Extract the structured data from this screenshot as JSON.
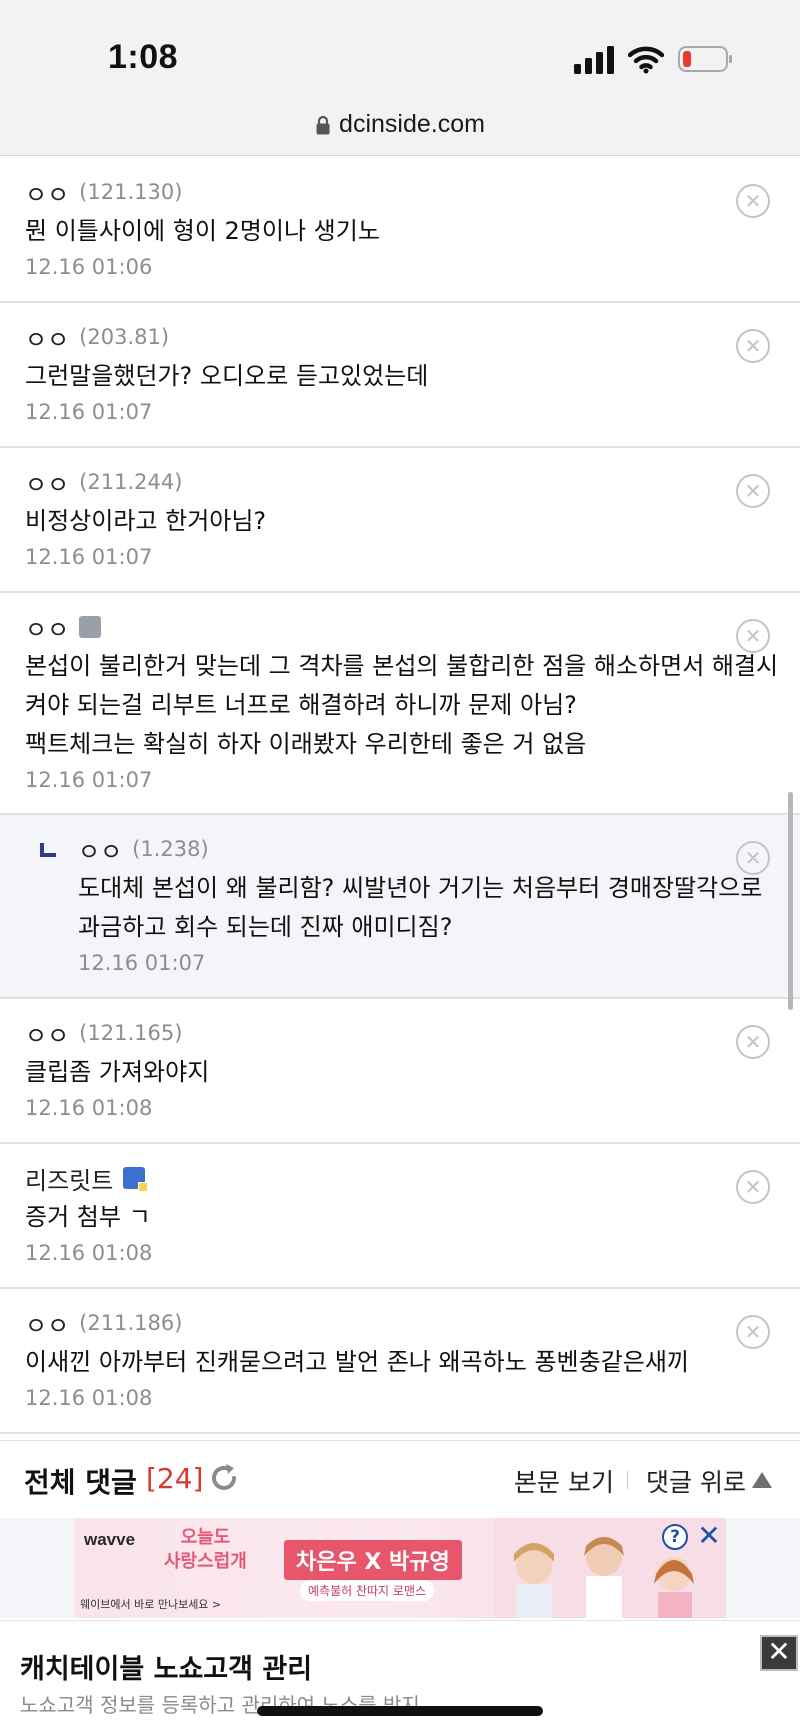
{
  "status_bar": {
    "time": "1:08"
  },
  "browser": {
    "url": "dcinside.com"
  },
  "comments": [
    {
      "nick": "ㅇㅇ",
      "ip": "(121.130)",
      "text": "뭔 이틀사이에 형이 2명이나 생기노",
      "date": "12.16 01:06"
    },
    {
      "nick": "ㅇㅇ",
      "ip": "(203.81)",
      "text": "그런말을했던가? 오디오로 듣고있었는데",
      "date": "12.16 01:07"
    },
    {
      "nick": "ㅇㅇ",
      "ip": "(211.244)",
      "text": "비정상이라고 한거아님?",
      "date": "12.16 01:07"
    },
    {
      "nick": "ㅇㅇ",
      "ip": "",
      "text": "본섭이 불리한거 맞는데 그 격차를 본섭의 불합리한 점을 해소하면서 해결시켜야 되는걸 리부트 너프로 해결하려 하니까 문제 아님?",
      "text2": "팩트체크는 확실히 하자 이래봤자 우리한테 좋은 거 없음",
      "date": "12.16 01:07"
    },
    {
      "nick": "ㅇㅇ",
      "ip": "(1.238)",
      "text": "도대체 본섭이 왜 불리함? 씨발년아 거기는 처음부터 경매장딸각으로 과금하고 회수 되는데 진짜 애미디짐?",
      "date": "12.16 01:07"
    },
    {
      "nick": "ㅇㅇ",
      "ip": "(121.165)",
      "text": "클립좀 가져와야지",
      "date": "12.16 01:08"
    },
    {
      "nick": "리즈릿트",
      "ip": "",
      "text": "증거 첨부 ㄱ",
      "date": "12.16 01:08"
    },
    {
      "nick": "ㅇㅇ",
      "ip": "(211.186)",
      "text": "이새낀 아까부터 진캐묻으려고 발언 존나 왜곡하노 퐁벤충같은새끼",
      "date": "12.16 01:08"
    }
  ],
  "total_bar": {
    "title": "전체 댓글",
    "count": "[24]",
    "view_post": "본문 보기",
    "to_comments": "댓글 위로"
  },
  "ad": {
    "brand": "wavve",
    "tagline_line1": "오늘도",
    "tagline_line2": "사랑스럽개",
    "cast": "차은우 X 박규영",
    "sub": "예측불허 찬따지 로맨스",
    "foot": "웨이브에서 바로 만나보세요 >",
    "help": "?",
    "close": "✕"
  },
  "bottom_ad": {
    "title": "캐치테이블 노쇼고객 관리",
    "subtitle": "노쇼고객 정보를 등록하고 관리하여 노쇼를 방지.",
    "close": "✕"
  },
  "colors": {
    "count_red": "#d53b2f",
    "reply_marker": "#2b3a8f",
    "reply_bg": "#f4f5f8"
  }
}
